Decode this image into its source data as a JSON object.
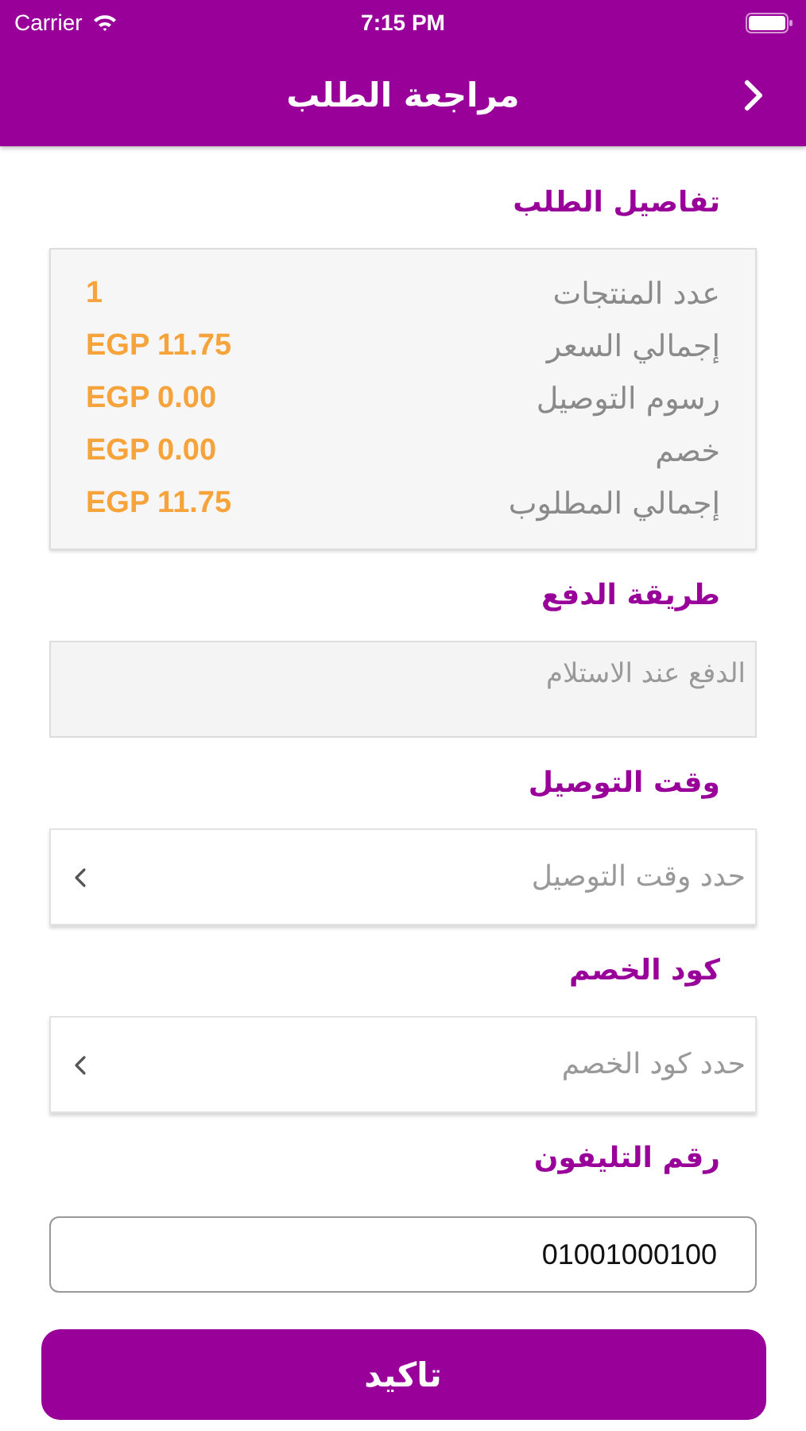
{
  "status_bar": {
    "carrier": "Carrier",
    "time": "7:15 PM"
  },
  "nav": {
    "title": "مراجعة الطلب"
  },
  "sections": [
    {
      "kind": "summary",
      "title": "تفاصيل الطلب",
      "rows": [
        {
          "label": "عدد المنتجات",
          "value": "1"
        },
        {
          "label": "إجمالي السعر",
          "value": "EGP 11.75"
        },
        {
          "label": "رسوم التوصيل",
          "value": "EGP 0.00"
        },
        {
          "label": "خصم",
          "value": "EGP 0.00"
        },
        {
          "label": "إجمالي المطلوب",
          "value": "EGP 11.75"
        }
      ]
    },
    {
      "kind": "text",
      "title": "طريقة الدفع",
      "value": "الدفع عند الاستلام"
    },
    {
      "kind": "select",
      "title": "وقت التوصيل",
      "placeholder": "حدد وقت التوصيل"
    },
    {
      "kind": "select",
      "title": "كود الخصم",
      "placeholder": "حدد كود الخصم"
    },
    {
      "kind": "input",
      "title": "رقم التليفون",
      "value": "01001000100"
    }
  ],
  "confirm_button": "تاكيد"
}
